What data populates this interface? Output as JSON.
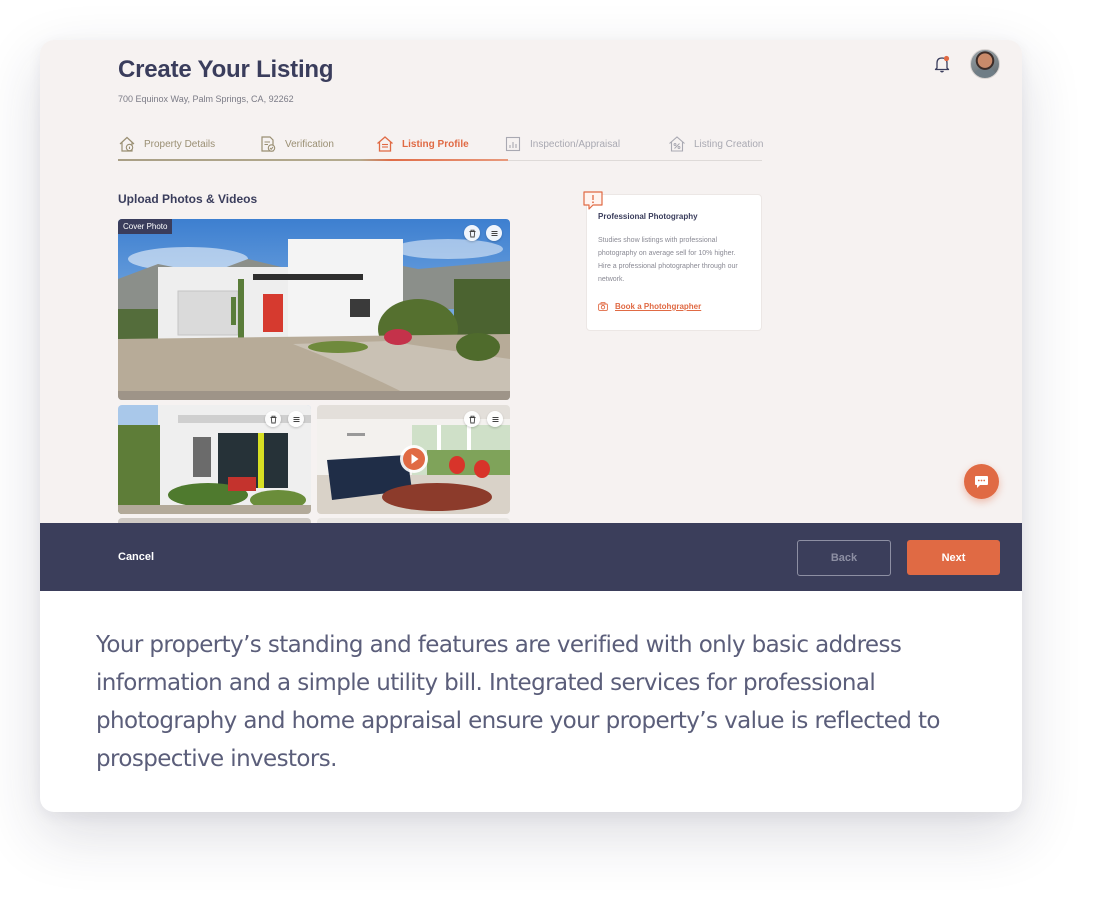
{
  "header": {
    "title": "Create Your Listing",
    "address": "700 Equinox Way, Palm Springs, CA, 92262"
  },
  "icons": {
    "notification": "bell-icon",
    "avatar": "user-avatar"
  },
  "steps": [
    {
      "label": "Property Details",
      "status": "done",
      "icon": "house-info-icon"
    },
    {
      "label": "Verification",
      "status": "done",
      "icon": "document-check-icon"
    },
    {
      "label": "Listing Profile",
      "status": "active",
      "icon": "house-list-icon"
    },
    {
      "label": "Inspection/Appraisal",
      "status": "todo",
      "icon": "chart-document-icon"
    },
    {
      "label": "Listing Creation",
      "status": "todo",
      "icon": "house-percent-icon"
    }
  ],
  "upload": {
    "title": "Upload Photos & Videos",
    "cover_label": "Cover Photo"
  },
  "tip": {
    "title": "Professional Photography",
    "body": "Studies show listings with professional photography on average sell for 10% higher. Hire a professional photographer through our network.",
    "link": "Book a Photohgrapher"
  },
  "footer": {
    "cancel": "Cancel",
    "back": "Back",
    "next": "Next"
  },
  "caption": "Your property’s standing and features are verified with only basic address information and a simple utility bill. Integrated services for professional photography and home appraisal ensure your property’s value is reflected to prospective investors.",
  "colors": {
    "accent": "#e06a44",
    "navy": "#3b3e5b",
    "done_step": "#9a8f73",
    "app_background": "#f6f2f1"
  }
}
